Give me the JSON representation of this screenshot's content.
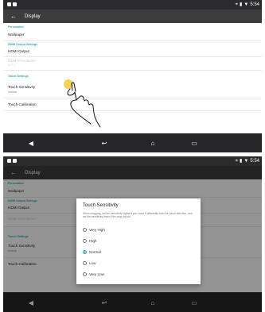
{
  "status_bar": {
    "time": "5:54",
    "wifi_icon": "wifi-icon",
    "battery_icon": "battery-icon"
  },
  "app_bar": {
    "title": "Display",
    "back_icon": "arrow-left-icon"
  },
  "settings": {
    "personalize": {
      "header": "Personalize",
      "wallpaper": "Wallpaper"
    },
    "hdmi": {
      "header": "HDMI Output Settings",
      "output": "HDMI Output",
      "resolution": "HDMI Resolution",
      "resolution_value": "AUTO"
    },
    "touch": {
      "header": "Touch Settings",
      "sensitivity": "Touch Sensitivity",
      "sensitivity_value": "Normal",
      "calibration": "Touch Calibration"
    }
  },
  "nav_bar": {
    "volume_icon": "volume-icon",
    "back_icon": "back-icon",
    "home_icon": "home-icon",
    "recents_icon": "recents-icon"
  },
  "dialog": {
    "title": "Touch Sensitivity",
    "message": "When dragging, set the sensitivity higher if you move it differently from the touch direction, and set the sensitivity lower if the stop occurs.",
    "options": [
      {
        "label": "Very High",
        "selected": false
      },
      {
        "label": "High",
        "selected": false
      },
      {
        "label": "Normal",
        "selected": true
      },
      {
        "label": "Low",
        "selected": false
      },
      {
        "label": "Very Low",
        "selected": false
      }
    ]
  },
  "colors": {
    "accent": "#3aa7a0",
    "status_bar": "#2b2b2d",
    "app_bar": "#3d3d3d",
    "nav_bar": "#262628",
    "scrim": "rgba(0,0,0,0.42)"
  }
}
